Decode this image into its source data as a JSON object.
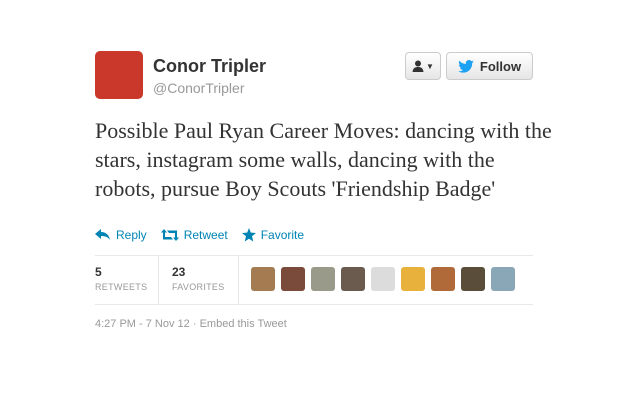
{
  "author": {
    "name": "Conor Tripler",
    "handle": "@ConorTripler",
    "avatar_color": "#c9382a"
  },
  "header_buttons": {
    "user_menu_icon": "user-dropdown-icon",
    "follow_label": "Follow"
  },
  "tweet": {
    "text": "Possible Paul Ryan Career Moves: dancing with the stars, instagram some walls, dancing with the robots, pursue Boy Scouts 'Friendship Badge'"
  },
  "actions": {
    "reply": "Reply",
    "retweet": "Retweet",
    "favorite": "Favorite"
  },
  "stats": {
    "retweets_count": "5",
    "retweets_label": "RETWEETS",
    "favorites_count": "23",
    "favorites_label": "FAVORITES"
  },
  "facepile_colors": [
    "#a57c52",
    "#7a4a3a",
    "#9a9a8a",
    "#6b5a4e",
    "#dcdcdc",
    "#e8b13b",
    "#b06a3a",
    "#5a4e3a",
    "#8aa7b8"
  ],
  "footer": {
    "timestamp": "4:27 PM - 7 Nov 12",
    "separator": "·",
    "embed": "Embed this Tweet"
  },
  "colors": {
    "link": "#0084b4",
    "twitter_bird": "#1da1f2"
  }
}
